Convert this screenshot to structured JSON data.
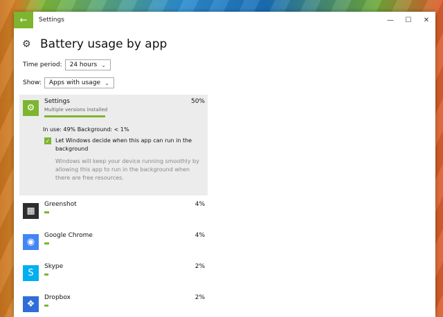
{
  "window": {
    "title": "Settings",
    "back_icon": "←",
    "minimize": "—",
    "maximize": "☐",
    "close": "✕"
  },
  "page": {
    "title": "Battery usage by app",
    "icon": "gear-icon"
  },
  "filters": {
    "time_label": "Time period:",
    "time_value": "24 hours",
    "show_label": "Show:",
    "show_value": "Apps with usage"
  },
  "expanded_app": {
    "name": "Settings",
    "subtitle": "Multiple versions installed",
    "percent": "50%",
    "usage_fraction": 0.5,
    "in_use_text": "In use: 49% Background: < 1%",
    "checkbox_label": "Let Windows decide when this app can run in the background",
    "checkbox_checked": true,
    "description": "Windows will keep your device running smoothly by allowing this app to run in the background when there are free resources."
  },
  "apps": [
    {
      "name": "Greenshot",
      "percent": "4%",
      "usage_fraction": 0.04,
      "icon": "greenshot-icon",
      "color": "#2d2d2d"
    },
    {
      "name": "Google Chrome",
      "percent": "4%",
      "usage_fraction": 0.04,
      "icon": "chrome-icon",
      "color": "#4285f4"
    },
    {
      "name": "Skype",
      "percent": "2%",
      "usage_fraction": 0.02,
      "icon": "skype-icon",
      "color": "#00aff0"
    },
    {
      "name": "Dropbox",
      "percent": "2%",
      "usage_fraction": 0.02,
      "icon": "dropbox-icon",
      "color": "#2f6ed8"
    }
  ],
  "colors": {
    "accent": "#7db52f"
  }
}
